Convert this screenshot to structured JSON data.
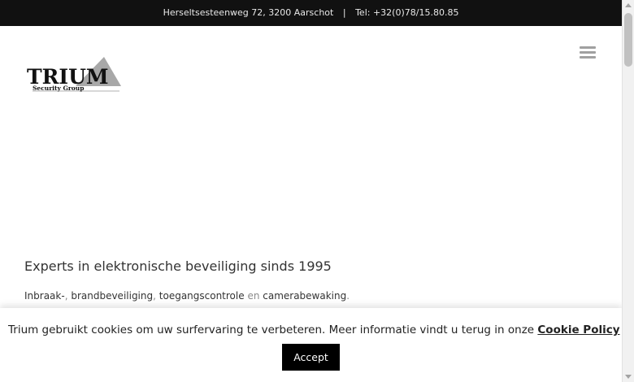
{
  "topbar": {
    "address": "Herseltsesteenweg 72, 3200 Aarschot",
    "separator": "|",
    "phone": "Tel: +32(0)78/15.80.85"
  },
  "logo": {
    "name": "TRIUM",
    "subtitle": "Security Group"
  },
  "hero": {
    "tagline": "Experts in elektronische beveiliging sinds 1995",
    "services": [
      "Inbraak-",
      "brandbeveiliging",
      "toegangscontrole",
      "camerabewaking"
    ],
    "sep_comma": ", ",
    "conjunction": " en ",
    "end_period": "."
  },
  "cookie": {
    "message": "Trium gebruikt cookies om uw surfervaring te verbeteren. Meer informatie vindt u terug in onze ",
    "policy_link": "Cookie Policy",
    "accept_label": "Accept"
  },
  "colors": {
    "topbar_bg": "#111111",
    "button_bg": "#000000",
    "logo_triangle": "#a8a8a8"
  },
  "icons": {
    "menu": "hamburger-menu-icon"
  }
}
